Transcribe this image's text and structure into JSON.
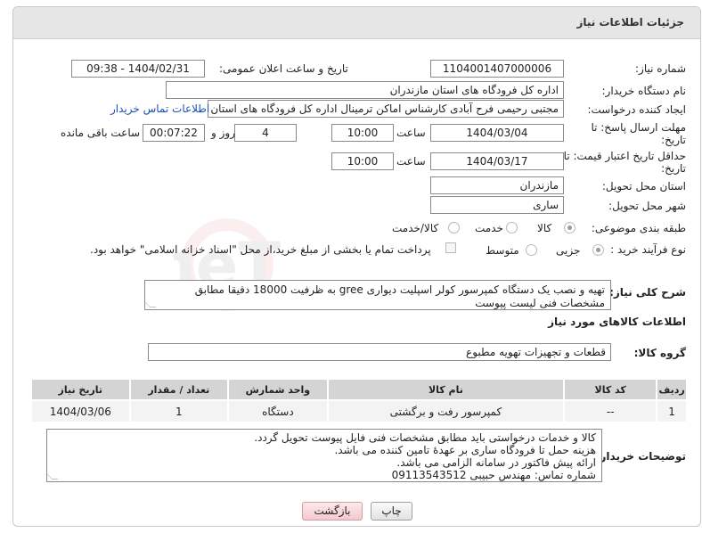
{
  "header": {
    "title": "جزئیات اطلاعات نیاز"
  },
  "form": {
    "need_number_label": "شماره نیاز:",
    "need_number": "1104001407000006",
    "announce_label": "تاریخ و ساعت اعلان عمومی:",
    "announce_value": "1404/02/31 - 09:38",
    "buyer_org_label": "نام دستگاه خریدار:",
    "buyer_org": "اداره کل فرودگاه های استان مازندران",
    "creator_label": "ایجاد کننده درخواست:",
    "creator": "مجتبی رحیمی فرح آبادی کارشناس اماکن ترمینال اداره کل فرودگاه های استان مازندران",
    "contact_link": "اطلاعات تماس خریدار",
    "deadline_label": "مهلت ارسال پاسخ: تا تاریخ:",
    "deadline_date": "1404/03/04",
    "time_label": "ساعت",
    "deadline_time": "10:00",
    "days": "4",
    "days_label": "روز و",
    "remaining": "00:07:22",
    "remaining_label": "ساعت باقی مانده",
    "price_validity_label": "حداقل تاریخ اعتبار قیمت: تا تاریخ:",
    "price_validity_date": "1404/03/17",
    "price_validity_time": "10:00",
    "province_label": "استان محل تحویل:",
    "province": "مازندران",
    "city_label": "شهر محل تحویل:",
    "city": "ساری",
    "category_label": "طبقه بندی موضوعی:",
    "category_options": [
      "کالا",
      "خدمت",
      "کالا/خدمت"
    ],
    "category_selected": "کالا",
    "process_label": "نوع فرآیند خرید :",
    "process_options": [
      "جزیی",
      "متوسط"
    ],
    "process_selected": "جزیی",
    "payment_note": "پرداخت تمام یا بخشی از مبلغ خرید،از محل \"اسناد خزانه اسلامی\" خواهد بود."
  },
  "description": {
    "label": "شرح کلی نیاز:",
    "text": "تهیه و نصب یک دستگاه کمپرسور کولر اسپلیت دیواری gree به ظرفیت 18000 دقیقا مطابق مشخصات فنی لیست پیوست"
  },
  "goods_section": {
    "title": "اطلاعات کالاهای مورد نیاز",
    "group_label": "گروه کالا:",
    "group_value": "قطعات و تجهیزات تهویه مطبوع"
  },
  "table": {
    "headers": [
      "ردیف",
      "کد کالا",
      "نام کالا",
      "واحد شمارش",
      "تعداد / مقدار",
      "تاریخ نیاز"
    ],
    "rows": [
      [
        "1",
        "--",
        "کمپرسور رفت و برگشتی",
        "دستگاه",
        "1",
        "1404/03/06"
      ]
    ]
  },
  "buyer_notes": {
    "label": "توضیحات خریدار:",
    "lines": [
      "کالا و خدمات درخواستی باید مطابق مشخصات فنی فایل پیوست تحویل گردد.",
      "هزینه حمل تا فرودگاه ساری بر عهدۀ تامین کننده می باشد.",
      "ارائه پیش فاکتور در سامانه الزامی می باشد.",
      "شماره تماس: مهندس حبیبی 09113543512"
    ]
  },
  "buttons": {
    "print": "چاپ",
    "back": "بازگشت"
  },
  "watermark": {
    "text": "AriaTender.neT"
  },
  "colors": {
    "link": "#1a4fb8",
    "header_bg": "#e6e6e6",
    "table_header_bg": "#d4d4d4"
  }
}
